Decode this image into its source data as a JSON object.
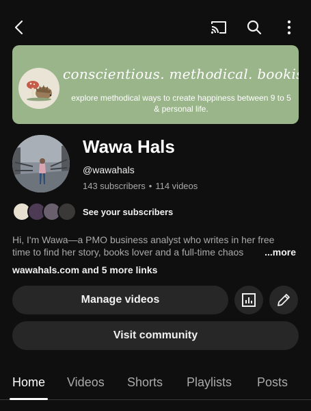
{
  "banner": {
    "title": "conscientious. methodical. bookish.",
    "subtitle": "explore methodical ways to create happiness between 9 to 5 & personal life."
  },
  "channel": {
    "name": "Wawa Hals",
    "handle": "@wawahals",
    "subscribers": "143 subscribers",
    "separator": "•",
    "videos": "114 videos"
  },
  "subscribers_link": "See your subscribers",
  "description": {
    "line1": "Hi, I'm Wawa—a PMO business analyst who writes in her free",
    "line2": "time to find her story, books lover and a full-time chaos",
    "more": "...more"
  },
  "links_text": "wawahals.com and 5 more links",
  "buttons": {
    "manage_videos": "Manage videos",
    "visit_community": "Visit community"
  },
  "tabs": [
    {
      "label": "Home",
      "active": true
    },
    {
      "label": "Videos",
      "active": false
    },
    {
      "label": "Shorts",
      "active": false
    },
    {
      "label": "Playlists",
      "active": false
    },
    {
      "label": "Posts",
      "active": false
    }
  ],
  "icons": {
    "back": "chevron-left-icon",
    "cast": "cast-icon",
    "search": "search-icon",
    "more": "more-vertical-icon",
    "analytics": "analytics-icon",
    "edit": "pencil-icon"
  },
  "colors": {
    "background": "#0f0f0f",
    "banner": "#9ab58a",
    "button": "#272727",
    "muted_text": "#aaaaaa"
  }
}
